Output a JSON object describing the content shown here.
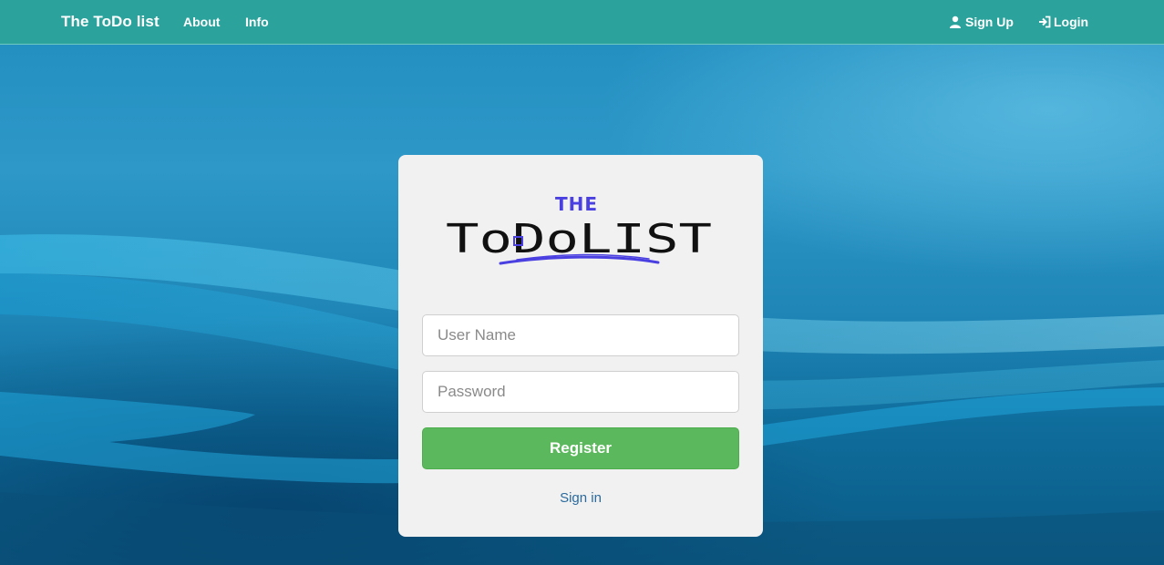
{
  "navbar": {
    "brand": "The ToDo list",
    "links": [
      {
        "label": "About"
      },
      {
        "label": "Info"
      }
    ],
    "signup_label": "Sign Up",
    "login_label": "Login",
    "colors": {
      "background": "#2ba39c",
      "text": "#ffffff"
    }
  },
  "card": {
    "logo": {
      "top_word": "THE",
      "main_text": "ToDoLIST",
      "icon": "checkbox-check-logo"
    },
    "username_placeholder": "User Name",
    "password_placeholder": "Password",
    "register_label": "Register",
    "signin_label": "Sign in",
    "colors": {
      "register": "#5cb85c",
      "link": "#2a6a9e",
      "card": "#f1f1f1"
    }
  },
  "icons": {
    "signup": "user-icon",
    "login": "login-arrow-icon"
  }
}
